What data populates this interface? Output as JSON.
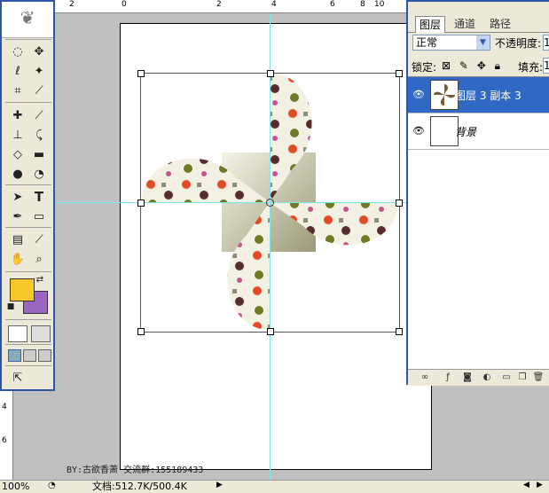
{
  "ruler": {
    "top_labels": [
      "2",
      "0",
      "2",
      "4",
      "6",
      "8",
      "10"
    ],
    "left_labels": [
      "4",
      "6"
    ]
  },
  "tools": [
    {
      "name": "feather-logo-icon",
      "glyph": "❦"
    },
    {
      "name": "marquee-tool-icon",
      "glyph": "◌"
    },
    {
      "name": "move-tool-icon",
      "glyph": "✥"
    },
    {
      "name": "lasso-tool-icon",
      "glyph": "ℓ"
    },
    {
      "name": "magic-wand-tool-icon",
      "glyph": "✦"
    },
    {
      "name": "crop-tool-icon",
      "glyph": "⌗"
    },
    {
      "name": "slice-tool-icon",
      "glyph": "⟋"
    },
    {
      "name": "healing-brush-tool-icon",
      "glyph": "✚"
    },
    {
      "name": "brush-tool-icon",
      "glyph": "⟋"
    },
    {
      "name": "stamp-tool-icon",
      "glyph": "⊥"
    },
    {
      "name": "history-brush-tool-icon",
      "glyph": "⤹"
    },
    {
      "name": "eraser-tool-icon",
      "glyph": "◇"
    },
    {
      "name": "gradient-tool-icon",
      "glyph": "▬"
    },
    {
      "name": "blur-tool-icon",
      "glyph": "●"
    },
    {
      "name": "dodge-tool-icon",
      "glyph": "◔"
    },
    {
      "name": "path-select-tool-icon",
      "glyph": "➤"
    },
    {
      "name": "type-tool-icon",
      "glyph": "T"
    },
    {
      "name": "pen-tool-icon",
      "glyph": "✒"
    },
    {
      "name": "shape-tool-icon",
      "glyph": "▭"
    },
    {
      "name": "notes-tool-icon",
      "glyph": "▤"
    },
    {
      "name": "eyedropper-tool-icon",
      "glyph": "⟋"
    },
    {
      "name": "hand-tool-icon",
      "glyph": "✋"
    },
    {
      "name": "zoom-tool-icon",
      "glyph": "⌕"
    }
  ],
  "colors": {
    "foreground": "#f7c828",
    "background": "#9b66c2",
    "selection": "#3168c6",
    "guide": "#7fe5e9"
  },
  "layers_panel": {
    "tabs": [
      "图层",
      "通道",
      "路径"
    ],
    "blend_mode": "正常",
    "opacity_label": "不透明度:",
    "opacity_value": "1",
    "lock_label": "锁定:",
    "fill_label": "填充:",
    "fill_value": "1",
    "layers": [
      {
        "name": "图层 3 副本 3",
        "visible": true,
        "selected": true
      },
      {
        "name": "背景",
        "visible": true,
        "selected": false
      }
    ]
  },
  "canvas": {
    "credit": "BY:古欲香萧 交流群:155189433"
  },
  "status": {
    "zoom": "100%",
    "doc": "文档:512.7K/500.4K"
  }
}
